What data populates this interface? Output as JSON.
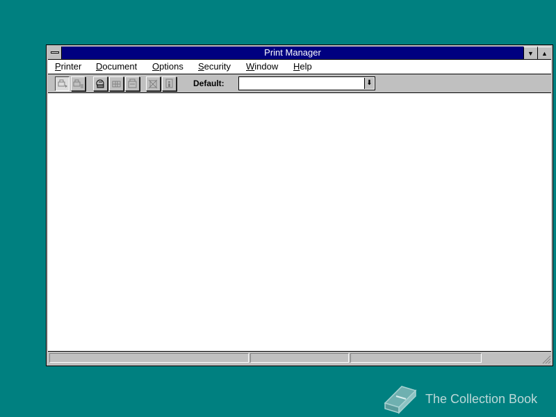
{
  "window": {
    "title": "Print Manager",
    "system_menu_icon": "system-menu-icon",
    "minimize_glyph": "▼",
    "maximize_glyph": "▲"
  },
  "menubar": {
    "items": [
      {
        "accel": "P",
        "rest": "rinter"
      },
      {
        "accel": "D",
        "rest": "ocument"
      },
      {
        "accel": "O",
        "rest": "ptions"
      },
      {
        "accel": "S",
        "rest": "ecurity"
      },
      {
        "accel": "W",
        "rest": "indow"
      },
      {
        "accel": "H",
        "rest": "elp"
      }
    ]
  },
  "toolbar": {
    "tools": [
      {
        "name": "connect-printer-icon",
        "pressed": true
      },
      {
        "name": "disconnect-printer-icon",
        "pressed": false
      },
      {
        "name": "printer-properties-icon",
        "pressed": false
      },
      {
        "name": "pause-printer-icon",
        "pressed": false
      },
      {
        "name": "resume-printer-icon",
        "pressed": false
      },
      {
        "name": "delete-document-icon",
        "pressed": false
      },
      {
        "name": "document-details-icon",
        "pressed": false
      }
    ],
    "default_label": "Default:",
    "default_value": "",
    "dropdown_glyph": "⬇"
  },
  "statusbar": {
    "panes": [
      "",
      "",
      "",
      ""
    ]
  },
  "watermark": {
    "text": "The Collection Book",
    "icon": "book-icon"
  },
  "colors": {
    "desktop": "#008080",
    "titlebar": "#000080",
    "face": "#c0c0c0"
  }
}
